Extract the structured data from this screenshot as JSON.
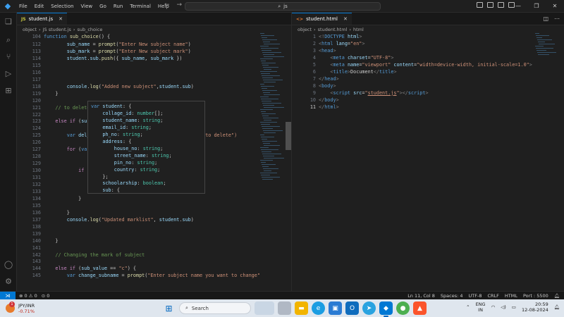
{
  "menu": [
    "File",
    "Edit",
    "Selection",
    "View",
    "Go",
    "Run",
    "Terminal",
    "Help"
  ],
  "command_center": "js",
  "left_group": {
    "tab": {
      "icon": "JS",
      "label": "student.js"
    },
    "breadcrumb": [
      "object",
      "JS student.js",
      "sub_choice"
    ],
    "lines": [
      {
        "n": "104",
        "cur": false,
        "html": "<span class=\"kw\">function</span> <span class=\"fn\">sub_choice</span>() {"
      },
      {
        "n": "112",
        "cur": false,
        "html": "        <span class=\"vr\">sub_name</span> = <span class=\"fn\">prompt</span>(<span class=\"st\">\"Enter New subject name\"</span>)"
      },
      {
        "n": "113",
        "cur": false,
        "html": "        <span class=\"vr\">sub_mark</span> = <span class=\"fn\">prompt</span>(<span class=\"st\">\"Enter New subject mark\"</span>)"
      },
      {
        "n": "114",
        "cur": false,
        "html": "        <span class=\"vr\">student</span>.<span class=\"vr\">sub</span>.<span class=\"fn\">push</span>({ <span class=\"vr\">sub_name</span>, <span class=\"vr\">sub_mark</span> })"
      },
      {
        "n": "115",
        "cur": false,
        "html": ""
      },
      {
        "n": "116",
        "cur": false,
        "html": ""
      },
      {
        "n": "117",
        "cur": false,
        "html": ""
      },
      {
        "n": "118",
        "cur": false,
        "html": "        <span class=\"vr\">console</span>.<span class=\"fn\">log</span>(<span class=\"st\">\"Added new subject\"</span>,<span class=\"vr\">student</span>.<span class=\"vr\">sub</span>)"
      },
      {
        "n": "119",
        "cur": false,
        "html": "    }"
      },
      {
        "n": "120",
        "cur": false,
        "html": ""
      },
      {
        "n": "121",
        "cur": false,
        "html": "    <span class=\"cm\">// to delete</span>"
      },
      {
        "n": "122",
        "cur": false,
        "html": ""
      },
      {
        "n": "123",
        "cur": false,
        "html": "    <span class=\"kc\">else if</span> (<span class=\"vr\">sub</span>"
      },
      {
        "n": "124",
        "cur": false,
        "html": ""
      },
      {
        "n": "125",
        "cur": false,
        "html": "        <span class=\"kw\">var</span> <span class=\"vr\">del_</span>                        <span class=\"st\">; name you want to delete\")</span>"
      },
      {
        "n": "126",
        "cur": false,
        "html": ""
      },
      {
        "n": "127",
        "cur": false,
        "html": "        <span class=\"kc\">for</span> (<span class=\"kw\">var</span>                        ; <span class=\"vr\">j</span>++) {"
      },
      {
        "n": "128",
        "cur": false,
        "html": ""
      },
      {
        "n": "129",
        "cur": false,
        "html": ""
      },
      {
        "n": "130",
        "cur": false,
        "html": "            <span class=\"kc\">if</span> (                        <span class=\"vr\">_subname</span>) {"
      },
      {
        "n": "131",
        "cur": false,
        "html": "                <span class=\"vr\">student</span>.<span class=\"vr\">sub</span>.<span class=\"fn\">splice</span>(<span class=\"vr\">j</span>, 1)"
      },
      {
        "n": "132",
        "cur": false,
        "html": ""
      },
      {
        "n": "133",
        "cur": false,
        "html": ""
      },
      {
        "n": "134",
        "cur": false,
        "html": "            }"
      },
      {
        "n": "135",
        "cur": false,
        "html": ""
      },
      {
        "n": "136",
        "cur": false,
        "html": "        }"
      },
      {
        "n": "137",
        "cur": false,
        "html": "        <span class=\"vr\">console</span>.<span class=\"fn\">log</span>(<span class=\"st\">\"Updated marklist\"</span>, <span class=\"vr\">student</span>.<span class=\"vr\">sub</span>)"
      },
      {
        "n": "138",
        "cur": false,
        "html": ""
      },
      {
        "n": "139",
        "cur": false,
        "html": ""
      },
      {
        "n": "140",
        "cur": false,
        "html": "    }"
      },
      {
        "n": "141",
        "cur": false,
        "html": ""
      },
      {
        "n": "142",
        "cur": false,
        "html": "    <span class=\"cm\">// Changing the mark of subject</span>"
      },
      {
        "n": "143",
        "cur": false,
        "html": ""
      },
      {
        "n": "144",
        "cur": false,
        "html": "    <span class=\"kc\">else if</span> (<span class=\"vr\">sub_value</span> == <span class=\"st\">\"c\"</span>) {"
      },
      {
        "n": "145",
        "cur": false,
        "html": "        <span class=\"kw\">var</span> <span class=\"vr\">change_subname</span> = <span class=\"fn\">prompt</span>(<span class=\"st\">\"Enter subject name you want to change\"</span>)"
      }
    ]
  },
  "hover": [
    "<span class=\"kw\">var</span> <span class=\"vr\">student</span>: {",
    "    <span class=\"vr\">collage_id</span>: <span class=\"ty\">number</span>[];",
    "    <span class=\"vr\">student_name</span>: <span class=\"ty\">string</span>;",
    "    <span class=\"vr\">email_id</span>: <span class=\"ty\">string</span>;",
    "    <span class=\"vr\">ph_no</span>: <span class=\"ty\">string</span>;",
    "    <span class=\"vr\">address</span>: {",
    "        <span class=\"vr\">house_no</span>: <span class=\"ty\">string</span>;",
    "        <span class=\"vr\">street_name</span>: <span class=\"ty\">string</span>;",
    "        <span class=\"vr\">pin_no</span>: <span class=\"ty\">string</span>;",
    "        <span class=\"vr\">country</span>: <span class=\"ty\">string</span>;",
    "    };",
    "    <span class=\"vr\">schoolarship</span>: <span class=\"ty\">boolean</span>;",
    "    <span class=\"vr\">sub</span>: {"
  ],
  "right_group": {
    "tab": {
      "icon": "<>",
      "label": "student.html"
    },
    "breadcrumb": [
      "object",
      "student.html",
      "html"
    ],
    "lines": [
      {
        "n": "1",
        "cur": false,
        "html": "<span class=\"pu\">&lt;!</span><span class=\"tg\">DOCTYPE</span> <span class=\"at\">html</span><span class=\"pu\">&gt;</span>"
      },
      {
        "n": "2",
        "cur": false,
        "html": "<span class=\"pu\">&lt;</span><span class=\"tg\">html</span> <span class=\"at\">lang</span>=<span class=\"st\">\"en\"</span><span class=\"pu\">&gt;</span>"
      },
      {
        "n": "3",
        "cur": false,
        "html": "<span class=\"pu\">&lt;</span><span class=\"tg\">head</span><span class=\"pu\">&gt;</span>"
      },
      {
        "n": "4",
        "cur": false,
        "html": "    <span class=\"pu\">&lt;</span><span class=\"tg\">meta</span> <span class=\"at\">charset</span>=<span class=\"st\">\"UTF-8\"</span><span class=\"pu\">&gt;</span>"
      },
      {
        "n": "5",
        "cur": false,
        "html": "    <span class=\"pu\">&lt;</span><span class=\"tg\">meta</span> <span class=\"at\">name</span>=<span class=\"st\">\"viewport\"</span> <span class=\"at\">content</span>=<span class=\"st\">\"width=device-width, initial-scale=1.0\"</span><span class=\"pu\">&gt;</span>"
      },
      {
        "n": "6",
        "cur": false,
        "html": "    <span class=\"pu\">&lt;</span><span class=\"tg\">title</span><span class=\"pu\">&gt;</span>Document<span class=\"pu\">&lt;/</span><span class=\"tg\">title</span><span class=\"pu\">&gt;</span>"
      },
      {
        "n": "7",
        "cur": false,
        "html": "<span class=\"pu\">&lt;/</span><span class=\"tg\">head</span><span class=\"pu\">&gt;</span>"
      },
      {
        "n": "8",
        "cur": false,
        "html": "<span class=\"pu\">&lt;</span><span class=\"tg\">body</span><span class=\"pu\">&gt;</span>"
      },
      {
        "n": "9",
        "cur": false,
        "html": "    <span class=\"pu\">&lt;</span><span class=\"tg\">script</span> <span class=\"at\">src</span>=<span class=\"st\">\"<u>student.js</u>\"</span><span class=\"pu\">&gt;&lt;/</span><span class=\"tg\">script</span><span class=\"pu\">&gt;</span>"
      },
      {
        "n": "10",
        "cur": false,
        "html": "<span class=\"pu\">&lt;/</span><span class=\"tg\">body</span><span class=\"pu\">&gt;</span>"
      },
      {
        "n": "11",
        "cur": true,
        "html": "<span class=\"pu\">&lt;/</span><span class=\"tg\">html</span><span class=\"pu\">&gt;</span>"
      }
    ]
  },
  "status": {
    "problems_errors": "0",
    "problems_warnings": "0",
    "ports": "0",
    "position": "Ln 11, Col 8",
    "spaces": "Spaces: 4",
    "encoding": "UTF-8",
    "eol": "CRLF",
    "language": "HTML",
    "port": "Port : 5500"
  },
  "taskbar": {
    "weather_badge": "1",
    "ticker": "JPY/INR",
    "change": "-0.71%",
    "search_placeholder": "Search",
    "lang_top": "ENG",
    "lang_bottom": "IN",
    "time": "20:59",
    "date": "12-08-2024"
  }
}
